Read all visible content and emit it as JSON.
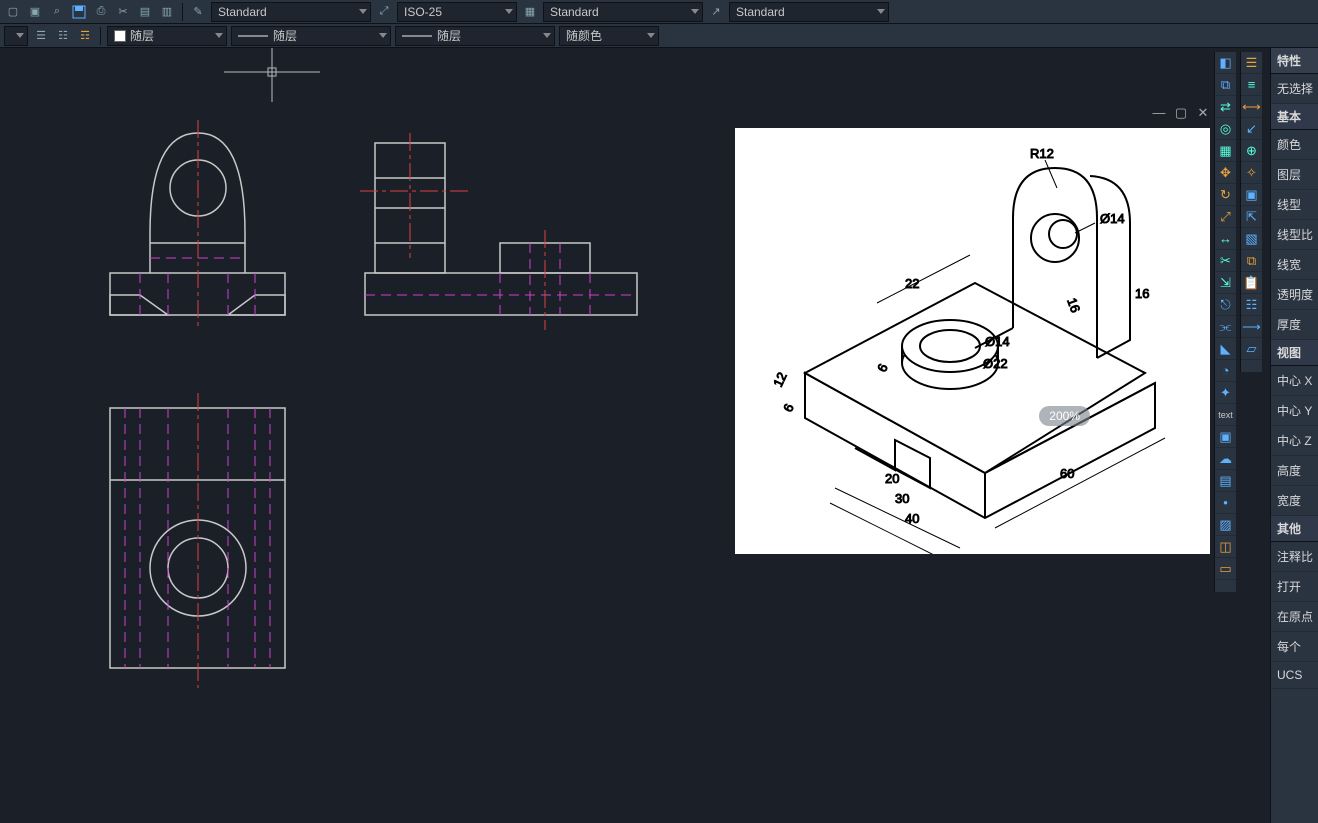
{
  "toolbar": {
    "dd_standard1": "Standard",
    "dd_iso": "ISO-25",
    "dd_standard2": "Standard",
    "dd_standard3": "Standard",
    "layer1": "随层",
    "layer2": "随层",
    "layer3": "随层",
    "color": "随颜色"
  },
  "ref": {
    "zoom": "200%",
    "dims": {
      "r12": "R12",
      "d14a": "Ø14",
      "d14b": "Ø14",
      "d22": "Ø22",
      "l22": "22",
      "l16a": "16",
      "l16b": "16",
      "l12": "12",
      "l6a": "6",
      "l6b": "6",
      "l20": "20",
      "l30": "30",
      "l40": "40",
      "l60": "60"
    }
  },
  "props": {
    "title": "特性",
    "selection": "无选择",
    "section_basic": "基本",
    "color": "颜色",
    "layer": "图层",
    "linetype": "线型",
    "linetype_scale": "线型比",
    "lineweight": "线宽",
    "transparency": "透明度",
    "thickness": "厚度",
    "section_view": "视图",
    "center_x": "中心 X",
    "center_y": "中心 Y",
    "center_z": "中心 Z",
    "height": "高度",
    "width": "宽度",
    "section_other": "其他",
    "anno": "注释比",
    "open": "打开",
    "origin": "在原点",
    "each": "每个",
    "ucs": "UCS"
  }
}
